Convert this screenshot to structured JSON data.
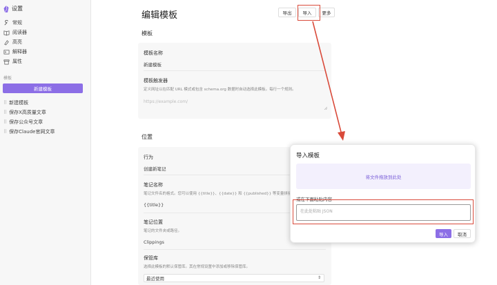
{
  "sidebar": {
    "title": "设置",
    "nav": [
      {
        "label": "常规",
        "icon": "wrench-icon"
      },
      {
        "label": "阅读器",
        "icon": "book-icon"
      },
      {
        "label": "高亮",
        "icon": "highlighter-icon"
      },
      {
        "label": "解释器",
        "icon": "terminal-icon"
      },
      {
        "label": "属性",
        "icon": "archive-icon"
      }
    ],
    "section_label": "模板",
    "new_template_label": "新建模板",
    "templates": [
      "新建模板",
      "保存X高质量文章",
      "保存公众号文章",
      "保存Claude官网文章"
    ]
  },
  "header": {
    "title": "编辑模板",
    "export_label": "导出",
    "import_label": "导入",
    "more_label": "更多"
  },
  "template_section": {
    "title": "模板",
    "name_label": "模板名称",
    "name_value": "新建模板",
    "trigger_label": "模板触发器",
    "trigger_desc": "定义网址以在匹配 URL 模式或包含 schema.org 数据时自动选择此模板。每行一个规则。",
    "trigger_placeholder": "https://example.com/"
  },
  "location_section": {
    "title": "位置",
    "behavior_label": "行为",
    "behavior_value": "创建新笔记",
    "note_name_label": "笔记名称",
    "note_name_desc": "笔记文件名的格式。您可以使用 {{title}}、{{date}} 和 {{published}} 等变量拼接自定义名称",
    "note_name_value": "{{title}}",
    "note_location_label": "笔记位置",
    "note_location_desc": "笔记的文件夹或路径。",
    "note_location_value": "Clippings",
    "vault_label": "保管库",
    "vault_desc": "选择此模板的默认保管库。其在常规设置中添加或移除保管库。",
    "vault_value": "最近使用"
  },
  "modal": {
    "title": "导入模板",
    "dropzone_text": "将文件拖放到此处",
    "paste_label": "或在下面粘贴内容",
    "paste_placeholder": "在此处粘贴 JSON",
    "import_label": "导入",
    "cancel_label": "取消"
  },
  "colors": {
    "accent": "#8c6ee6",
    "annotation": "#d94a3a"
  }
}
